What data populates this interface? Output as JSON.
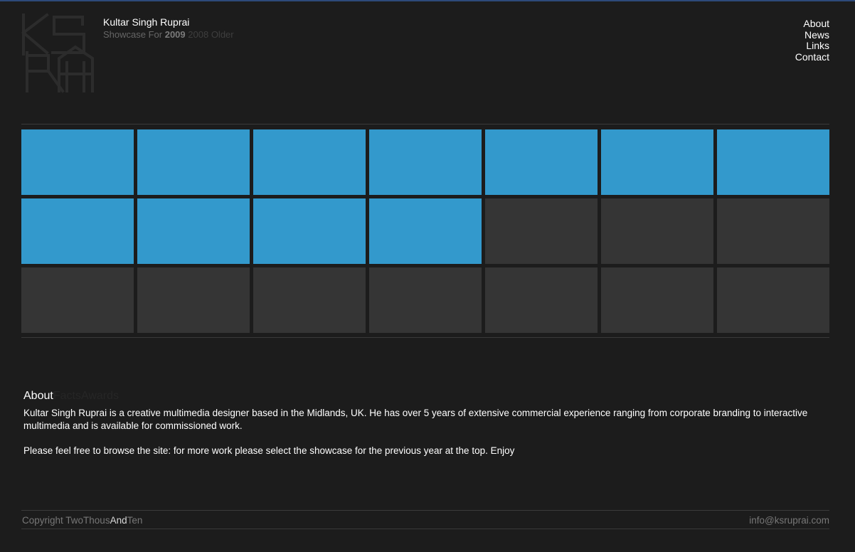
{
  "header": {
    "name": "Kultar Singh Ruprai",
    "showcase_label": "Showcase For",
    "year_current": "2009",
    "year_prev": "2008",
    "year_older": "Older"
  },
  "nav": {
    "about": "About",
    "news": "News",
    "links": "Links",
    "contact": "Contact"
  },
  "grid": {
    "columns": 7,
    "rows": 3,
    "filled_count": 11,
    "filled_color": "#3399cc",
    "empty_color": "#353535"
  },
  "about": {
    "tab_about": "About",
    "tab_facts": "Facts",
    "tab_awards": "Awards",
    "paragraph1": "Kultar Singh Ruprai is a creative multimedia designer based in the Midlands, UK. He has over 5 years of extensive commercial experience ranging from corporate branding to interactive multimedia and is available for commissioned work.",
    "paragraph2": "Please feel free to browse the site: for more work please select the showcase for the previous year at the top. Enjoy"
  },
  "footer": {
    "copyright_pre": "Copyright TwoThous",
    "copyright_and": "And",
    "copyright_post": "Ten",
    "email": "info@ksruprai.com"
  },
  "colors": {
    "background": "#1c1c1c",
    "accent": "#3399cc",
    "rule": "#3a3a3a"
  }
}
